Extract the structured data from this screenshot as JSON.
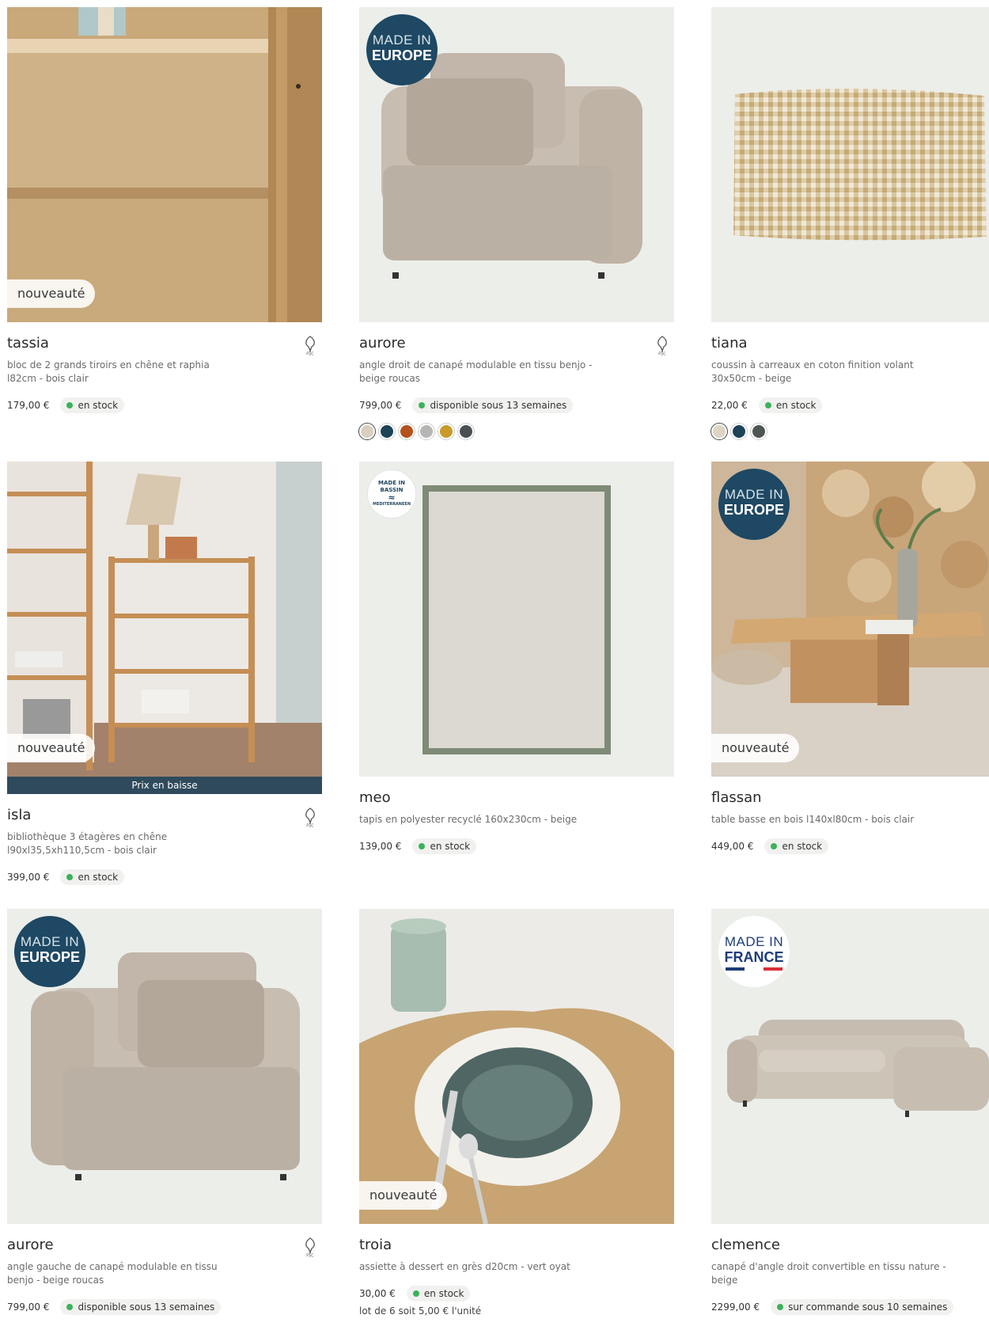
{
  "badges": {
    "new_label": "nouveauté",
    "price_drop_label": "Prix en baisse",
    "made_in": "MADE IN",
    "europe": "EUROPE",
    "france": "FRANCE",
    "bassin_top": "MADE IN",
    "bassin_mid": "BASSIN",
    "bassin_bottom": "MEDITERRANEEN"
  },
  "colors": {
    "badge_navy": "#1e4863",
    "stock_green": "#3cb25a",
    "flag_blue": "#1d3d7a",
    "flag_white": "#ffffff",
    "flag_red": "#d6303a"
  },
  "products": [
    {
      "name": "tassia",
      "desc": "bloc de 2 grands tiroirs en chêne et raphia l82cm - bois clair",
      "price": "179,00 €",
      "stock": "en stock",
      "fsc": true,
      "icon": "fsc-tree-icon"
    },
    {
      "name": "aurore",
      "desc": "angle droit de canapé modulable en tissu benjo - beige roucas",
      "price": "799,00 €",
      "stock": "disponible sous 13 semaines",
      "fsc": true,
      "swatches": [
        "#d8cfbf",
        "#1e4357",
        "#b4511c",
        "#b6b6b4",
        "#c89a2a",
        "#4b4f52"
      ]
    },
    {
      "name": "tiana",
      "desc": "coussin à carreaux en coton finition volant 30x50cm - beige",
      "price": "22,00 €",
      "stock": "en stock",
      "swatches": [
        "#ddd5c2",
        "#1e4357",
        "#4e5552"
      ]
    },
    {
      "name": "isla",
      "desc": "bibliothèque 3 étagères en chêne l90xl35,5xh110,5cm - bois clair",
      "price": "399,00 €",
      "stock": "en stock",
      "fsc": true
    },
    {
      "name": "meo",
      "desc": "tapis en polyester recyclé 160x230cm - beige",
      "price": "139,00 €",
      "stock": "en stock"
    },
    {
      "name": "flassan",
      "desc": "table basse en bois l140xl80cm - bois clair",
      "price": "449,00 €",
      "stock": "en stock"
    },
    {
      "name": "aurore",
      "desc": "angle gauche de canapé modulable en tissu benjo - beige roucas",
      "price": "799,00 €",
      "stock": "disponible sous 13 semaines",
      "fsc": true
    },
    {
      "name": "troia",
      "desc": "assiette à dessert en grès d20cm - vert oyat",
      "price": "30,00 €",
      "stock": "en stock",
      "unit_note": "lot de 6 soit 5,00 € l'unité"
    },
    {
      "name": "clemence",
      "desc": "canapé d'angle droit convertible en tissu nature - beige",
      "price": "2299,00 €",
      "stock": "sur commande sous 10 semaines"
    }
  ]
}
